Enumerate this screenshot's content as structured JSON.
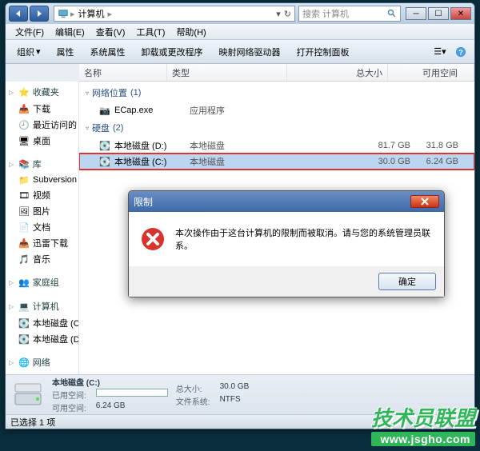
{
  "address": {
    "crumb": "计算机",
    "search_placeholder": "搜索 计算机"
  },
  "menu": {
    "file": "文件(F)",
    "edit": "编辑(E)",
    "view": "查看(V)",
    "tools": "工具(T)",
    "help": "帮助(H)"
  },
  "toolbar": {
    "organize": "组织",
    "properties": "属性",
    "system_props": "系统属性",
    "uninstall": "卸载或更改程序",
    "map_drive": "映射网络驱动器",
    "control_panel": "打开控制面板"
  },
  "columns": {
    "name": "名称",
    "type": "类型",
    "total": "总大小",
    "free": "可用空间"
  },
  "sidebar": {
    "favorites_label": "收藏夹",
    "favorites": [
      {
        "label": "下载"
      },
      {
        "label": "最近访问的"
      },
      {
        "label": "桌面"
      }
    ],
    "libraries_label": "库",
    "libraries": [
      {
        "label": "Subversion"
      },
      {
        "label": "视频"
      },
      {
        "label": "图片"
      },
      {
        "label": "文档"
      },
      {
        "label": "迅雷下载"
      },
      {
        "label": "音乐"
      }
    ],
    "homegroup_label": "家庭组",
    "computer_label": "计算机",
    "computer_items": [
      {
        "label": "本地磁盘 (C"
      },
      {
        "label": "本地磁盘 (D"
      }
    ],
    "network_label": "网络"
  },
  "groups": {
    "net_loc": {
      "label": "网络位置",
      "count": "(1)"
    },
    "disks": {
      "label": "硬盘",
      "count": "(2)"
    }
  },
  "items": {
    "ecap": {
      "name": "ECap.exe",
      "type": "应用程序"
    },
    "d": {
      "name": "本地磁盘 (D:)",
      "type": "本地磁盘",
      "total": "81.7 GB",
      "free": "31.8 GB"
    },
    "c": {
      "name": "本地磁盘 (C:)",
      "type": "本地磁盘",
      "total": "30.0 GB",
      "free": "6.24 GB"
    }
  },
  "details": {
    "title": "本地磁盘 (C:)",
    "used_label": "已用空间:",
    "free_label": "可用空间:",
    "free_val": "6.24 GB",
    "total_label": "总大小:",
    "total_val": "30.0 GB",
    "fs_label": "文件系统:",
    "fs_val": "NTFS"
  },
  "status": {
    "selected": "已选择 1 项"
  },
  "dialog": {
    "title": "限制",
    "message": "本次操作由于这台计算机的限制而被取消。请与您的系统管理员联系。",
    "ok": "确定"
  },
  "watermark": {
    "line1": "技术员联盟",
    "line2": "www.jsgho.com"
  }
}
